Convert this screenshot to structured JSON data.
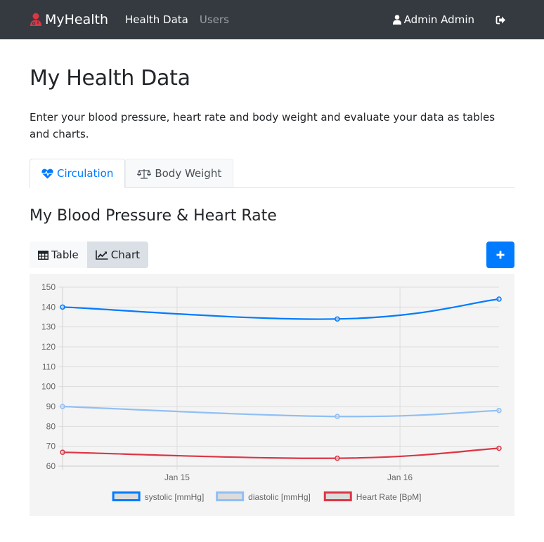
{
  "navbar": {
    "brand": "MyHealth",
    "brand_icon": "user-doctor-icon",
    "links": [
      {
        "label": "Health Data",
        "active": true
      },
      {
        "label": "Users",
        "active": false
      }
    ],
    "user_label": "Admin Admin",
    "user_icon": "user-icon",
    "logout_icon": "sign-out-icon"
  },
  "page": {
    "title": "My Health Data",
    "lead": "Enter your blood pressure, heart rate and body weight and evaluate your data as tables and charts."
  },
  "tabs": [
    {
      "label": "Circulation",
      "icon": "heartbeat-icon",
      "active": true
    },
    {
      "label": "Body Weight",
      "icon": "balance-scale-icon",
      "active": false
    }
  ],
  "section": {
    "title": "My Blood Pressure & Heart Rate",
    "view_toggle": [
      {
        "label": "Table",
        "icon": "table-icon",
        "active": false
      },
      {
        "label": "Chart",
        "icon": "line-chart-icon",
        "active": true
      }
    ],
    "add_icon": "plus-icon"
  },
  "colors": {
    "systolic": "#007bff",
    "diastolic": "#8fbff5",
    "heart_rate": "#dc3545",
    "navbar": "#343a40",
    "primary": "#007bff"
  },
  "chart_data": {
    "type": "line",
    "title": "",
    "xlabel": "",
    "ylabel": "",
    "x": [
      "Jan 14 11:40",
      "Jan 15 17:15",
      "Jan 16 10:40"
    ],
    "x_ticks": [
      "Jan 15",
      "Jan 16"
    ],
    "y_ticks": [
      60,
      70,
      80,
      90,
      100,
      110,
      120,
      130,
      140,
      150
    ],
    "ylim": [
      60,
      150
    ],
    "grid": true,
    "legend_position": "bottom",
    "series": [
      {
        "name": "systolic [mmHg]",
        "values": [
          140,
          134,
          144
        ],
        "color": "#007bff"
      },
      {
        "name": "diastolic [mmHg]",
        "values": [
          90,
          85,
          88
        ],
        "color": "#8fbff5"
      },
      {
        "name": "Heart Rate [BpM]",
        "values": [
          67,
          64,
          69
        ],
        "color": "#dc3545"
      }
    ]
  }
}
